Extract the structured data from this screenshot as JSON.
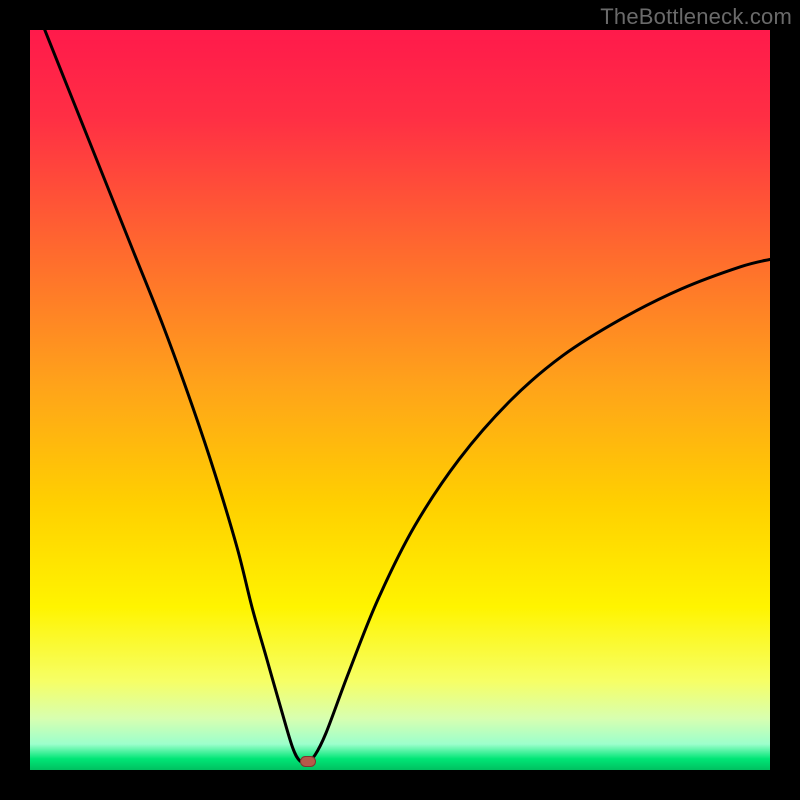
{
  "watermark": "TheBottleneck.com",
  "colors": {
    "background": "#000000",
    "gradient_stops": [
      {
        "offset": 0.0,
        "color": "#ff1a4b"
      },
      {
        "offset": 0.12,
        "color": "#ff2f44"
      },
      {
        "offset": 0.3,
        "color": "#ff6a2e"
      },
      {
        "offset": 0.48,
        "color": "#ffa31a"
      },
      {
        "offset": 0.64,
        "color": "#ffd000"
      },
      {
        "offset": 0.78,
        "color": "#fff400"
      },
      {
        "offset": 0.88,
        "color": "#f6ff66"
      },
      {
        "offset": 0.93,
        "color": "#d8ffb0"
      },
      {
        "offset": 0.965,
        "color": "#9cffcc"
      },
      {
        "offset": 0.985,
        "color": "#00e676"
      },
      {
        "offset": 1.0,
        "color": "#00c060"
      }
    ],
    "curve": "#000000",
    "marker_fill": "#b55a4a",
    "marker_stroke": "#7a3a30"
  },
  "chart_data": {
    "type": "line",
    "title": "",
    "xlabel": "",
    "ylabel": "",
    "xlim": [
      0,
      100
    ],
    "ylim": [
      0,
      100
    ],
    "grid": false,
    "curve_points": [
      {
        "x": 2,
        "y": 100
      },
      {
        "x": 6,
        "y": 90
      },
      {
        "x": 10,
        "y": 80
      },
      {
        "x": 14,
        "y": 70
      },
      {
        "x": 18,
        "y": 60
      },
      {
        "x": 22,
        "y": 49
      },
      {
        "x": 25,
        "y": 40
      },
      {
        "x": 28,
        "y": 30
      },
      {
        "x": 30,
        "y": 22
      },
      {
        "x": 32,
        "y": 15
      },
      {
        "x": 34,
        "y": 8
      },
      {
        "x": 35.5,
        "y": 3
      },
      {
        "x": 36.5,
        "y": 1.2
      },
      {
        "x": 37.5,
        "y": 1.2
      },
      {
        "x": 38.5,
        "y": 2
      },
      {
        "x": 40,
        "y": 5
      },
      {
        "x": 43,
        "y": 13
      },
      {
        "x": 47,
        "y": 23
      },
      {
        "x": 52,
        "y": 33
      },
      {
        "x": 58,
        "y": 42
      },
      {
        "x": 65,
        "y": 50
      },
      {
        "x": 72,
        "y": 56
      },
      {
        "x": 80,
        "y": 61
      },
      {
        "x": 88,
        "y": 65
      },
      {
        "x": 96,
        "y": 68
      },
      {
        "x": 100,
        "y": 69
      }
    ],
    "marker": {
      "x": 37.5,
      "y": 1.2
    }
  }
}
